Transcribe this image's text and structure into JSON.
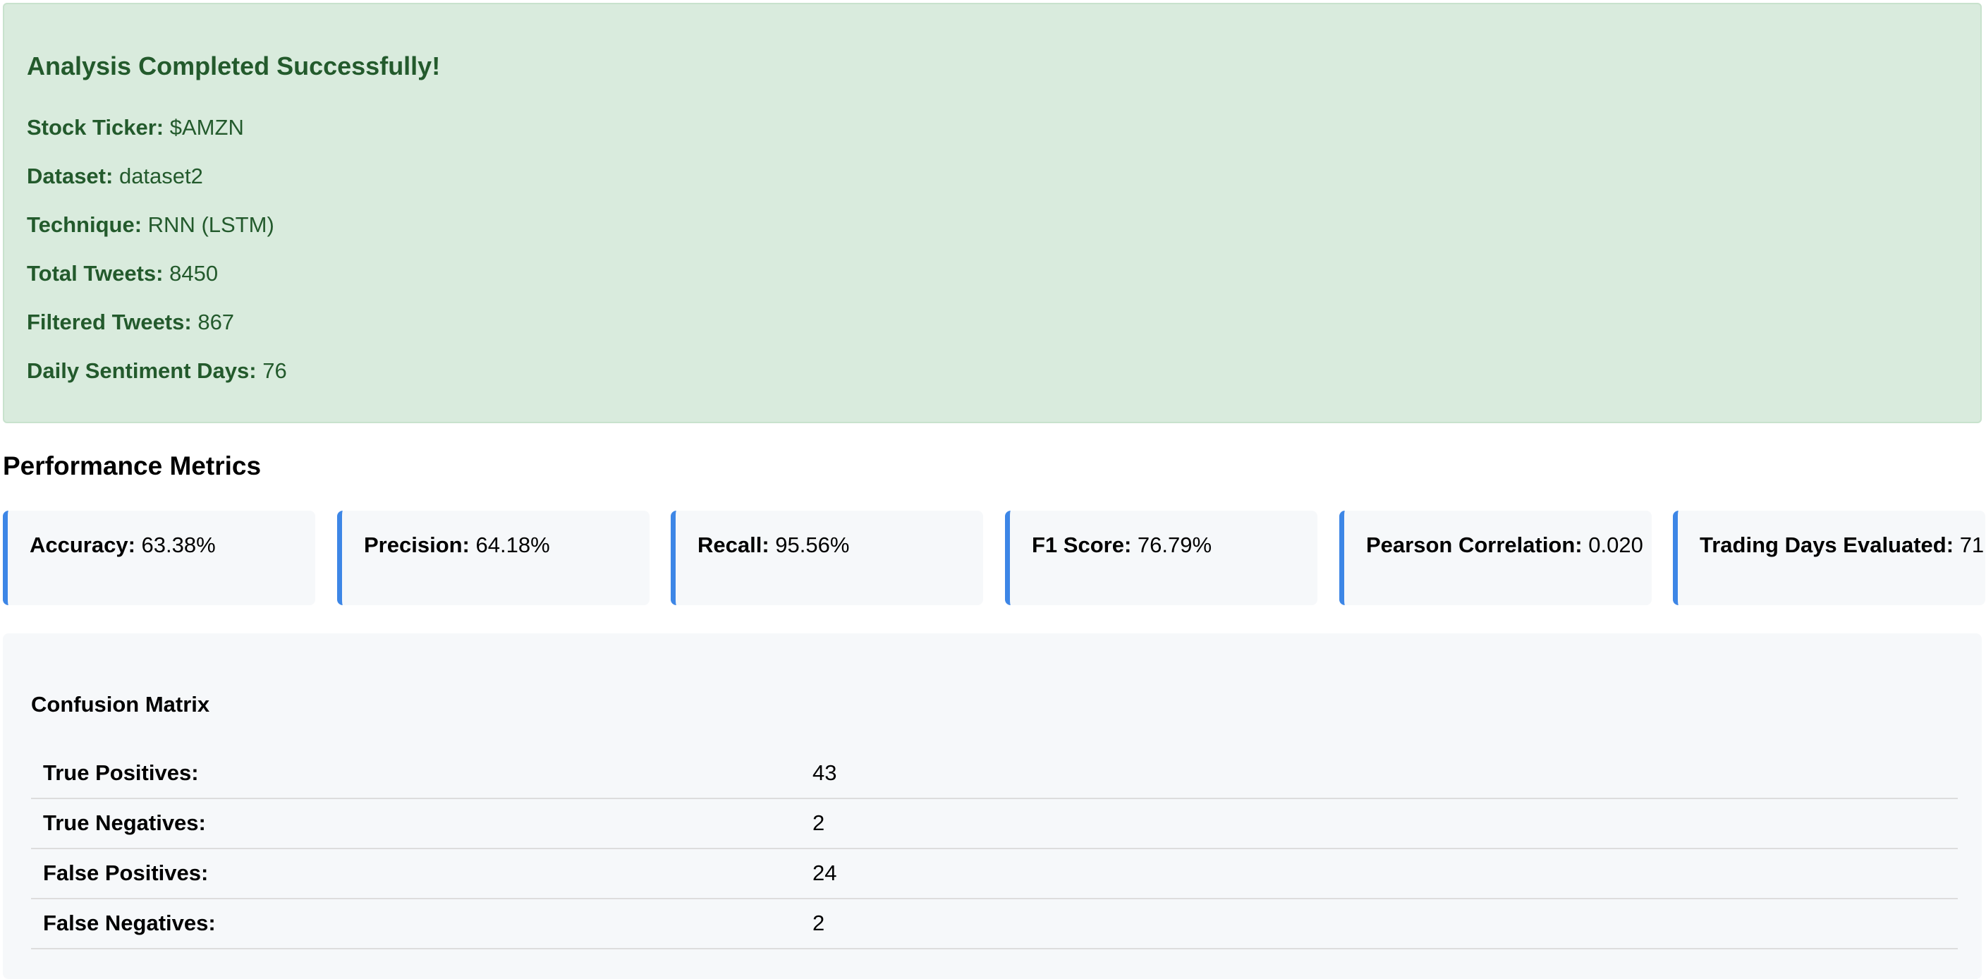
{
  "summary": {
    "title": "Analysis Completed Successfully!",
    "stock_ticker": {
      "label": "Stock Ticker:",
      "value": "$AMZN"
    },
    "dataset": {
      "label": "Dataset:",
      "value": "dataset2"
    },
    "technique": {
      "label": "Technique:",
      "value": "RNN (LSTM)"
    },
    "total_tweets": {
      "label": "Total Tweets:",
      "value": "8450"
    },
    "filtered_tweets": {
      "label": "Filtered Tweets:",
      "value": "867"
    },
    "daily_sentiment_days": {
      "label": "Daily Sentiment Days:",
      "value": "76"
    }
  },
  "metrics": {
    "title": "Performance Metrics",
    "items": [
      {
        "label": "Accuracy:",
        "value": "63.38%"
      },
      {
        "label": "Precision:",
        "value": "64.18%"
      },
      {
        "label": "Recall:",
        "value": "95.56%"
      },
      {
        "label": "F1 Score:",
        "value": "76.79%"
      },
      {
        "label": "Pearson Correlation:",
        "value": "0.020"
      },
      {
        "label": "Trading Days Evaluated:",
        "value": "71"
      }
    ]
  },
  "confusion_matrix": {
    "title": "Confusion Matrix",
    "rows": [
      {
        "label": "True Positives:",
        "value": "43"
      },
      {
        "label": "True Negatives:",
        "value": "2"
      },
      {
        "label": "False Positives:",
        "value": "24"
      },
      {
        "label": "False Negatives:",
        "value": "2"
      }
    ]
  },
  "colors": {
    "success_bg": "#d9ebdd",
    "success_text": "#235a2c",
    "accent": "#3d86e6",
    "card_bg": "#f6f8fa"
  }
}
